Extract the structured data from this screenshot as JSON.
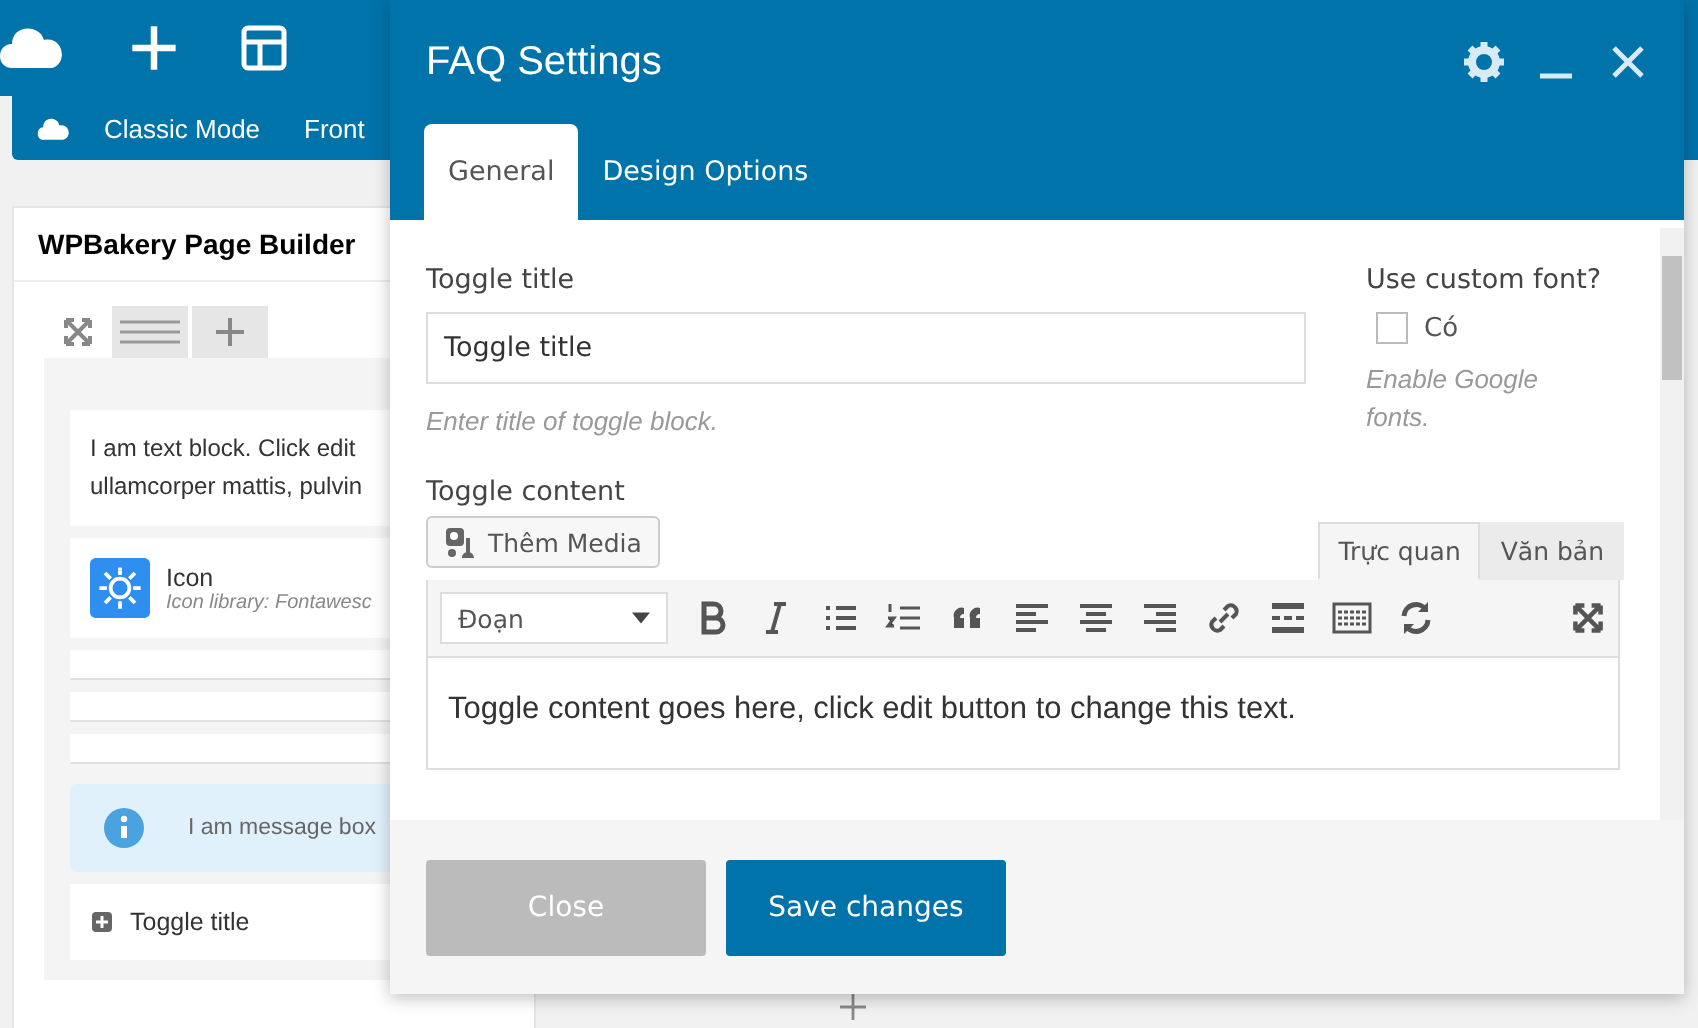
{
  "mode_bar": {
    "items": [
      "Classic Mode",
      "Front"
    ]
  },
  "builder": {
    "title": "WPBakery Page Builder",
    "elements": [
      {
        "kind": "text",
        "lines": [
          "I am text block. Click edit",
          "ullamcorper mattis, pulvin"
        ]
      },
      {
        "kind": "icon",
        "title": "Icon",
        "subtitle": "Icon library: Fontawesc"
      },
      {
        "kind": "empty"
      },
      {
        "kind": "empty"
      },
      {
        "kind": "empty"
      },
      {
        "kind": "message",
        "text": "I am message box"
      },
      {
        "kind": "toggle",
        "title": "Toggle title"
      }
    ]
  },
  "modal": {
    "title": "FAQ Settings",
    "tabs": [
      {
        "label": "General",
        "selected": true
      },
      {
        "label": "Design Options",
        "selected": false
      }
    ],
    "toggle_title": {
      "label": "Toggle title",
      "value": "Toggle title",
      "hint": "Enter title of toggle block."
    },
    "custom_font": {
      "label": "Use custom font?",
      "option": "Có",
      "checked": false,
      "hint": "Enable Google fonts."
    },
    "toggle_content": {
      "label": "Toggle content",
      "media_button": "Thêm Media",
      "editor_tabs": [
        {
          "label": "Trực quan",
          "selected": true
        },
        {
          "label": "Văn bản",
          "selected": false
        }
      ],
      "format": "Đoạn",
      "content": "Toggle content goes here, click edit button to change this text."
    },
    "buttons": [
      {
        "kind": "secondary",
        "label": "Close"
      },
      {
        "kind": "primary",
        "label": "Save changes"
      }
    ]
  }
}
